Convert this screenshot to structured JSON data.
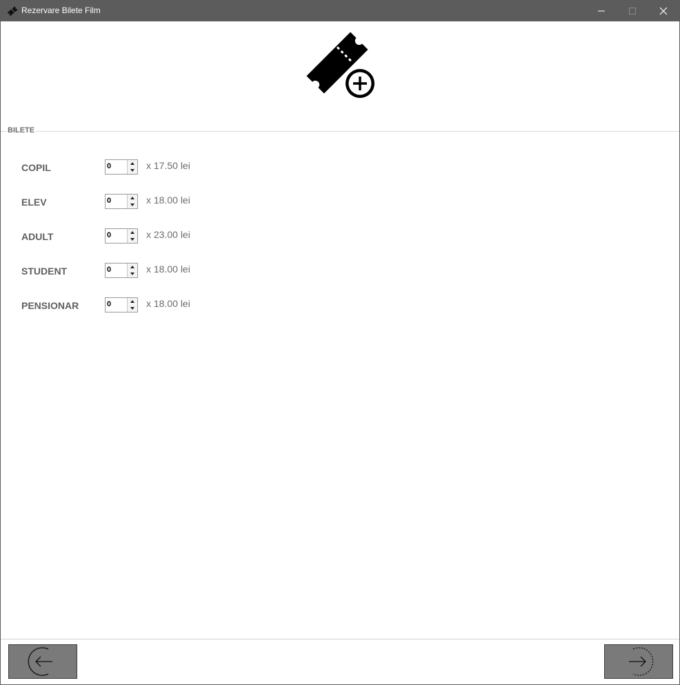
{
  "window": {
    "title": "Rezervare Bilete Film",
    "title_icon": "ticket-icon",
    "controls": [
      "minimize-icon",
      "maximize-icon",
      "close-icon"
    ]
  },
  "header": {
    "icon": "ticket-add-icon"
  },
  "tickets": {
    "group_label": "BILETE",
    "rows": [
      {
        "label": "COPIL",
        "quantity": "0",
        "price": "x 17.50 lei"
      },
      {
        "label": "ELEV",
        "quantity": "0",
        "price": "x 18.00 lei"
      },
      {
        "label": "ADULT",
        "quantity": "0",
        "price": "x 23.00 lei"
      },
      {
        "label": "STUDENT",
        "quantity": "0",
        "price": "x 18.00 lei"
      },
      {
        "label": "PENSIONAR",
        "quantity": "0",
        "price": "x 18.00 lei"
      }
    ]
  },
  "footer": {
    "back_icon": "arrow-left-circle-icon",
    "next_icon": "arrow-right-circle-icon"
  },
  "colors": {
    "titlebar": "#5c5c5c",
    "nav_button": "#7a7a7a",
    "label_text": "#5f5f5f"
  }
}
